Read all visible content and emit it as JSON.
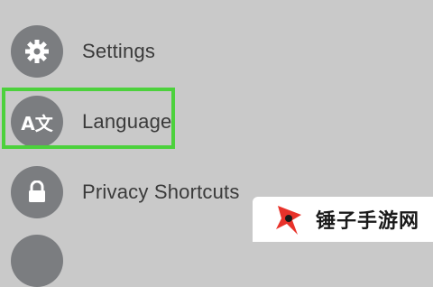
{
  "menu": {
    "items": [
      {
        "label": "Settings",
        "icon": "gear-icon"
      },
      {
        "label": "Language",
        "icon": "translate-icon",
        "icon_text": "A文",
        "highlighted": true
      },
      {
        "label": "Privacy Shortcuts",
        "icon": "lock-icon"
      }
    ]
  },
  "colors": {
    "background": "#c9c9c9",
    "icon_circle": "#7b7d80",
    "highlight": "#4cd13c"
  },
  "watermark": {
    "text": "锤子手游网",
    "logo": "star-logo-icon"
  }
}
